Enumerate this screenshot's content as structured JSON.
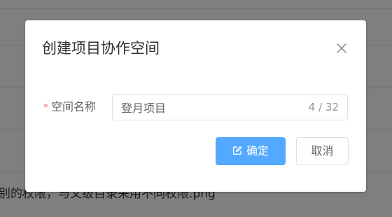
{
  "background": {
    "partial_text": "别的权限，与文级目录采用不同权限.png"
  },
  "dialog": {
    "title": "创建项目协作空间",
    "form": {
      "required_mark": "*",
      "label": "空间名称",
      "input_value": "登月项目",
      "count_text": "4 / 32"
    },
    "confirm_label": "确定",
    "cancel_label": "取消"
  },
  "icons": {
    "close": "close-icon",
    "confirm": "edit-icon"
  },
  "colors": {
    "primary": "#53a8ff",
    "required": "#f56c6c",
    "mask": "rgba(0,0,0,0.5)"
  }
}
